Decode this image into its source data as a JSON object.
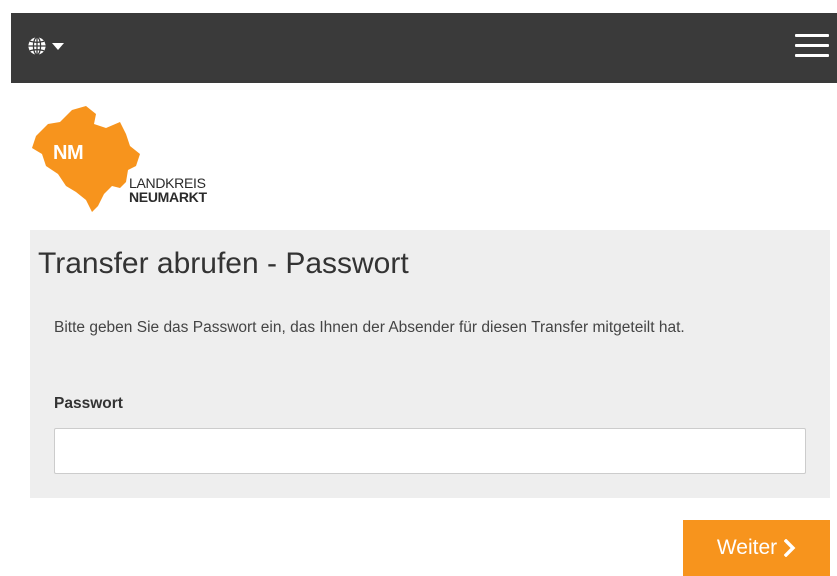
{
  "header": {
    "language_icon": "globe-icon",
    "dropdown_icon": "caret-down-icon",
    "menu_icon": "hamburger-menu-icon",
    "background_color": "#3a3a3a"
  },
  "logo": {
    "badge": "NM",
    "line1": "LANDKREIS",
    "line2": "NEUMARKT",
    "color": "#f7941d"
  },
  "form": {
    "title": "Transfer abrufen - Passwort",
    "description": "Bitte geben Sie das Passwort ein, das Ihnen der Absender für diesen Transfer mitgeteilt hat.",
    "password_label": "Passwort",
    "password_value": "",
    "password_placeholder": ""
  },
  "actions": {
    "next_label": "Weiter",
    "next_icon": "chevron-right-icon",
    "accent_color": "#f7941d"
  }
}
